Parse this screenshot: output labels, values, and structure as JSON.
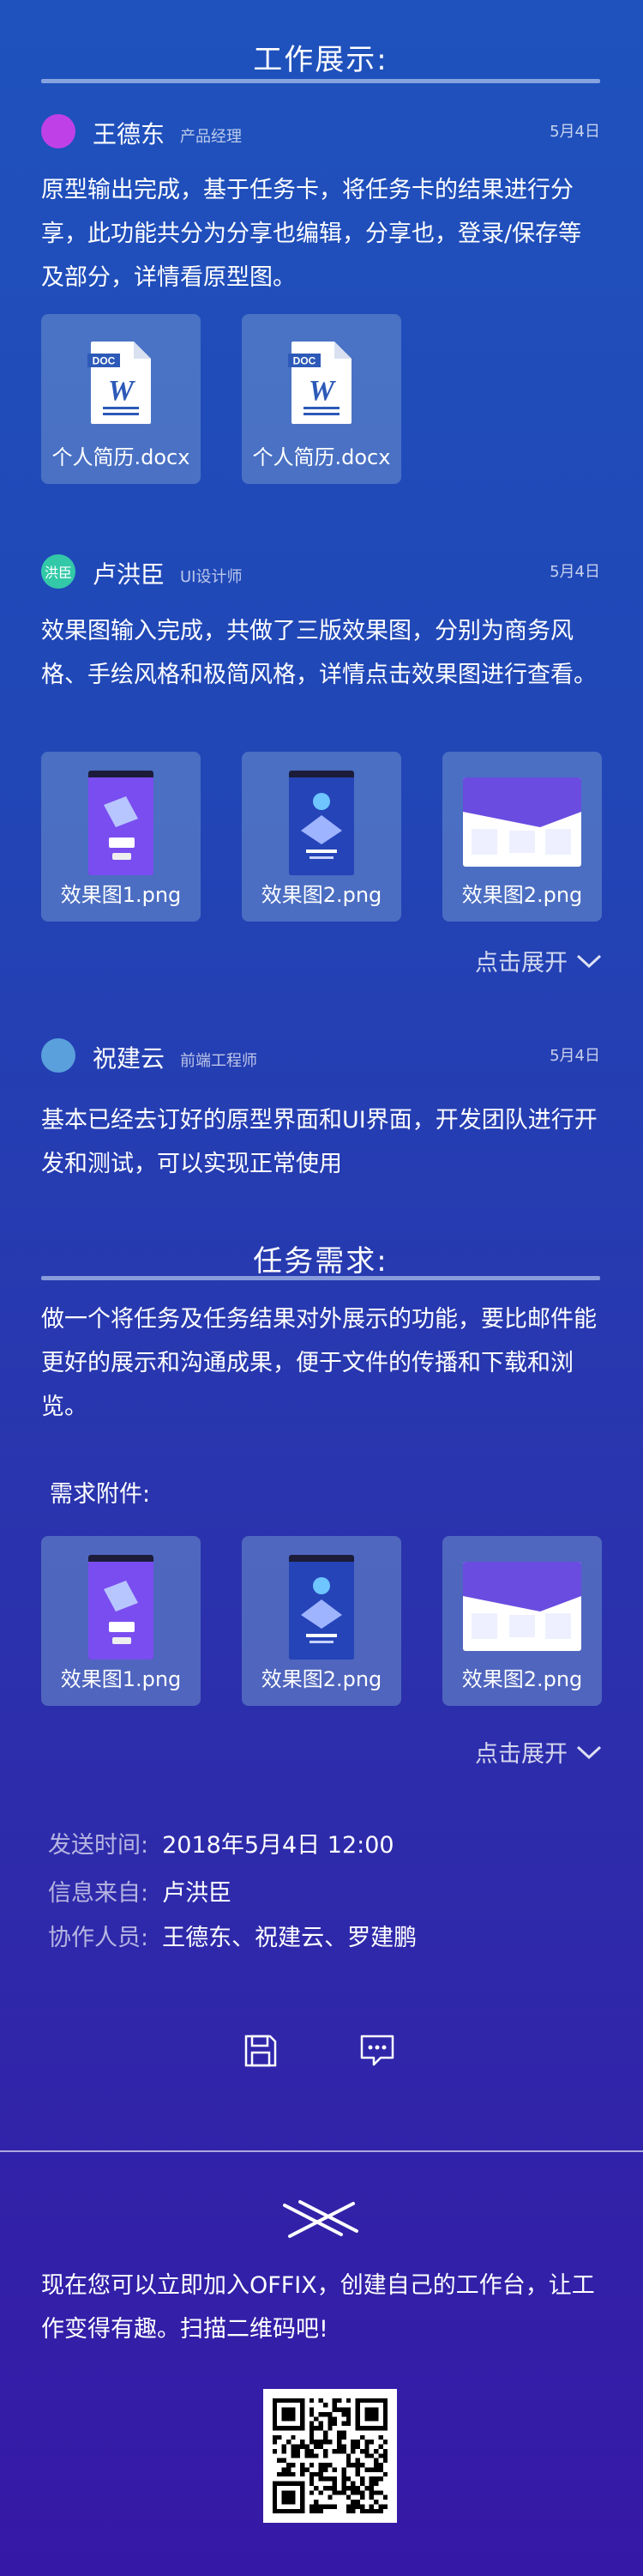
{
  "work_section": {
    "title": "工作展示:"
  },
  "posts": [
    {
      "author": "王德东",
      "role": "产品经理",
      "date": "5月4日",
      "avatar_color": "#c040e8",
      "text": "原型输出完成，基于任务卡，将任务卡的结果进行分享，此功能共分为分享也编辑，分享也，登录/保存等及部分，详情看原型图。",
      "attachments": [
        {
          "name": "个人简历.docx",
          "icon": "word-doc-icon"
        },
        {
          "name": "个人简历.docx",
          "icon": "word-doc-icon"
        }
      ]
    },
    {
      "author": "卢洪臣",
      "avatar_text": "洪臣",
      "role": "UI设计师",
      "date": "5月4日",
      "avatar_color": "#33c9a8",
      "text": "效果图输入完成，共做了三版效果图，分别为商务风格、手绘风格和极简风格，详情点击效果图进行查看。",
      "attachments": [
        {
          "name": "效果图1.png"
        },
        {
          "name": "效果图2.png"
        },
        {
          "name": "效果图2.png"
        }
      ],
      "expand_label": "点击展开"
    },
    {
      "author": "祝建云",
      "role": "前端工程师",
      "date": "5月4日",
      "avatar_color": "#5aa0dc",
      "text": "基本已经去订好的原型界面和UI界面，开发团队进行开发和测试，可以实现正常使用"
    }
  ],
  "task_section": {
    "title": "任务需求:",
    "text": "做一个将任务及任务结果对外展示的功能，要比邮件能更好的展示和沟通成果，便于文件的传播和下载和浏览。",
    "attachments_label": "需求附件:",
    "attachments": [
      {
        "name": "效果图1.png"
      },
      {
        "name": "效果图2.png"
      },
      {
        "name": "效果图2.png"
      }
    ],
    "expand_label": "点击展开"
  },
  "meta": {
    "send_time_label": "发送时间:",
    "send_time": "2018年5月4日 12:00",
    "source_label": "信息来自:",
    "source": "卢洪臣",
    "collaborators_label": "协作人员:",
    "collaborators": "王德东、祝建云、罗建鹏"
  },
  "actions": {
    "save_icon": "save-icon",
    "comment_icon": "comment-icon"
  },
  "footer": {
    "logo_icon": "offix-logo",
    "text": "现在您可以立即加入OFFIX，创建自己的工作台，让工作变得有趣。扫描二维码吧!"
  }
}
